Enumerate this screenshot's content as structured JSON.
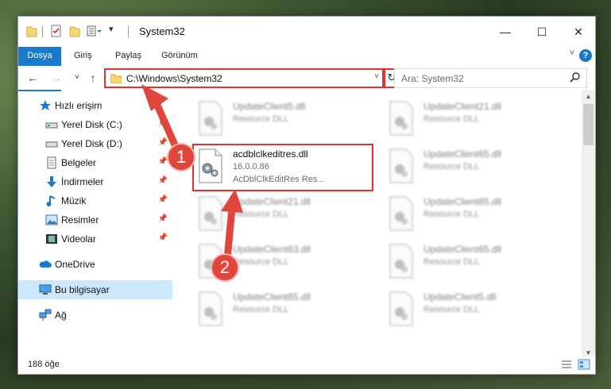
{
  "window": {
    "title": "System32",
    "minimize_glyph": "—",
    "maximize_glyph": "☐",
    "close_glyph": "✕"
  },
  "ribbon": {
    "tabs": [
      "Dosya",
      "Giriş",
      "Paylaş",
      "Görünüm"
    ],
    "help_label": "?"
  },
  "navigation": {
    "back_glyph": "←",
    "forward_glyph": "→",
    "recent_glyph": "˅",
    "up_glyph": "↑",
    "address_path": "C:\\Windows\\System32",
    "refresh_glyph": "↻",
    "search_placeholder": "Ara: System32"
  },
  "sidebar": {
    "items": [
      {
        "label": "Hızlı erişim",
        "icon": "star-icon",
        "pinned": false
      },
      {
        "label": "Yerel Disk (C:)",
        "icon": "drive-icon",
        "pinned": true
      },
      {
        "label": "Yerel Disk (D:)",
        "icon": "drive-icon",
        "pinned": true
      },
      {
        "label": "Belgeler",
        "icon": "documents-icon",
        "pinned": true
      },
      {
        "label": "İndirmeler",
        "icon": "downloads-icon",
        "pinned": true
      },
      {
        "label": "Müzik",
        "icon": "music-icon",
        "pinned": true
      },
      {
        "label": "Resimler",
        "icon": "pictures-icon",
        "pinned": true
      },
      {
        "label": "Videolar",
        "icon": "videos-icon",
        "pinned": true
      },
      {
        "label": "OneDrive",
        "icon": "cloud-icon",
        "pinned": false
      },
      {
        "label": "Bu bilgisayar",
        "icon": "computer-icon",
        "pinned": false,
        "selected": true
      },
      {
        "label": "Ağ",
        "icon": "network-icon",
        "pinned": false
      }
    ]
  },
  "files": [
    {
      "name": "UpdateClient5.dll",
      "version": "",
      "description": "Resource DLL",
      "blurred": true
    },
    {
      "name": "UpdateClient21.dll",
      "version": "",
      "description": "Resource DLL",
      "blurred": true
    },
    {
      "name": "acdblclkeditres.dll",
      "version": "16.0.0.86",
      "description": "AcDblClkEditRes Res...",
      "blurred": false,
      "highlighted": true
    },
    {
      "name": "UpdateClient65.dll",
      "version": "",
      "description": "Resource DLL",
      "blurred": true
    },
    {
      "name": "UpdateClient21.dll",
      "version": "",
      "description": "Resource DLL",
      "blurred": true
    },
    {
      "name": "UpdateClient65.dll",
      "version": "",
      "description": "Resource DLL",
      "blurred": true
    },
    {
      "name": "UpdateClient63.dll",
      "version": "",
      "description": "Resource DLL",
      "blurred": true
    },
    {
      "name": "UpdateClient65.dll",
      "version": "",
      "description": "Resource DLL",
      "blurred": true
    },
    {
      "name": "UpdateClient65.dll",
      "version": "",
      "description": "Resource DLL",
      "blurred": true
    },
    {
      "name": "UpdateClient5.dll",
      "version": "",
      "description": "Resource DLL",
      "blurred": true
    }
  ],
  "status": {
    "item_count": "188 öğe"
  },
  "annotations": [
    {
      "number": "1",
      "target": "address-bar"
    },
    {
      "number": "2",
      "target": "acdblclkeditres.dll"
    }
  ],
  "colors": {
    "accent": "#1979ca",
    "annotation_red": "#e03030",
    "selection": "#cce8ff"
  }
}
